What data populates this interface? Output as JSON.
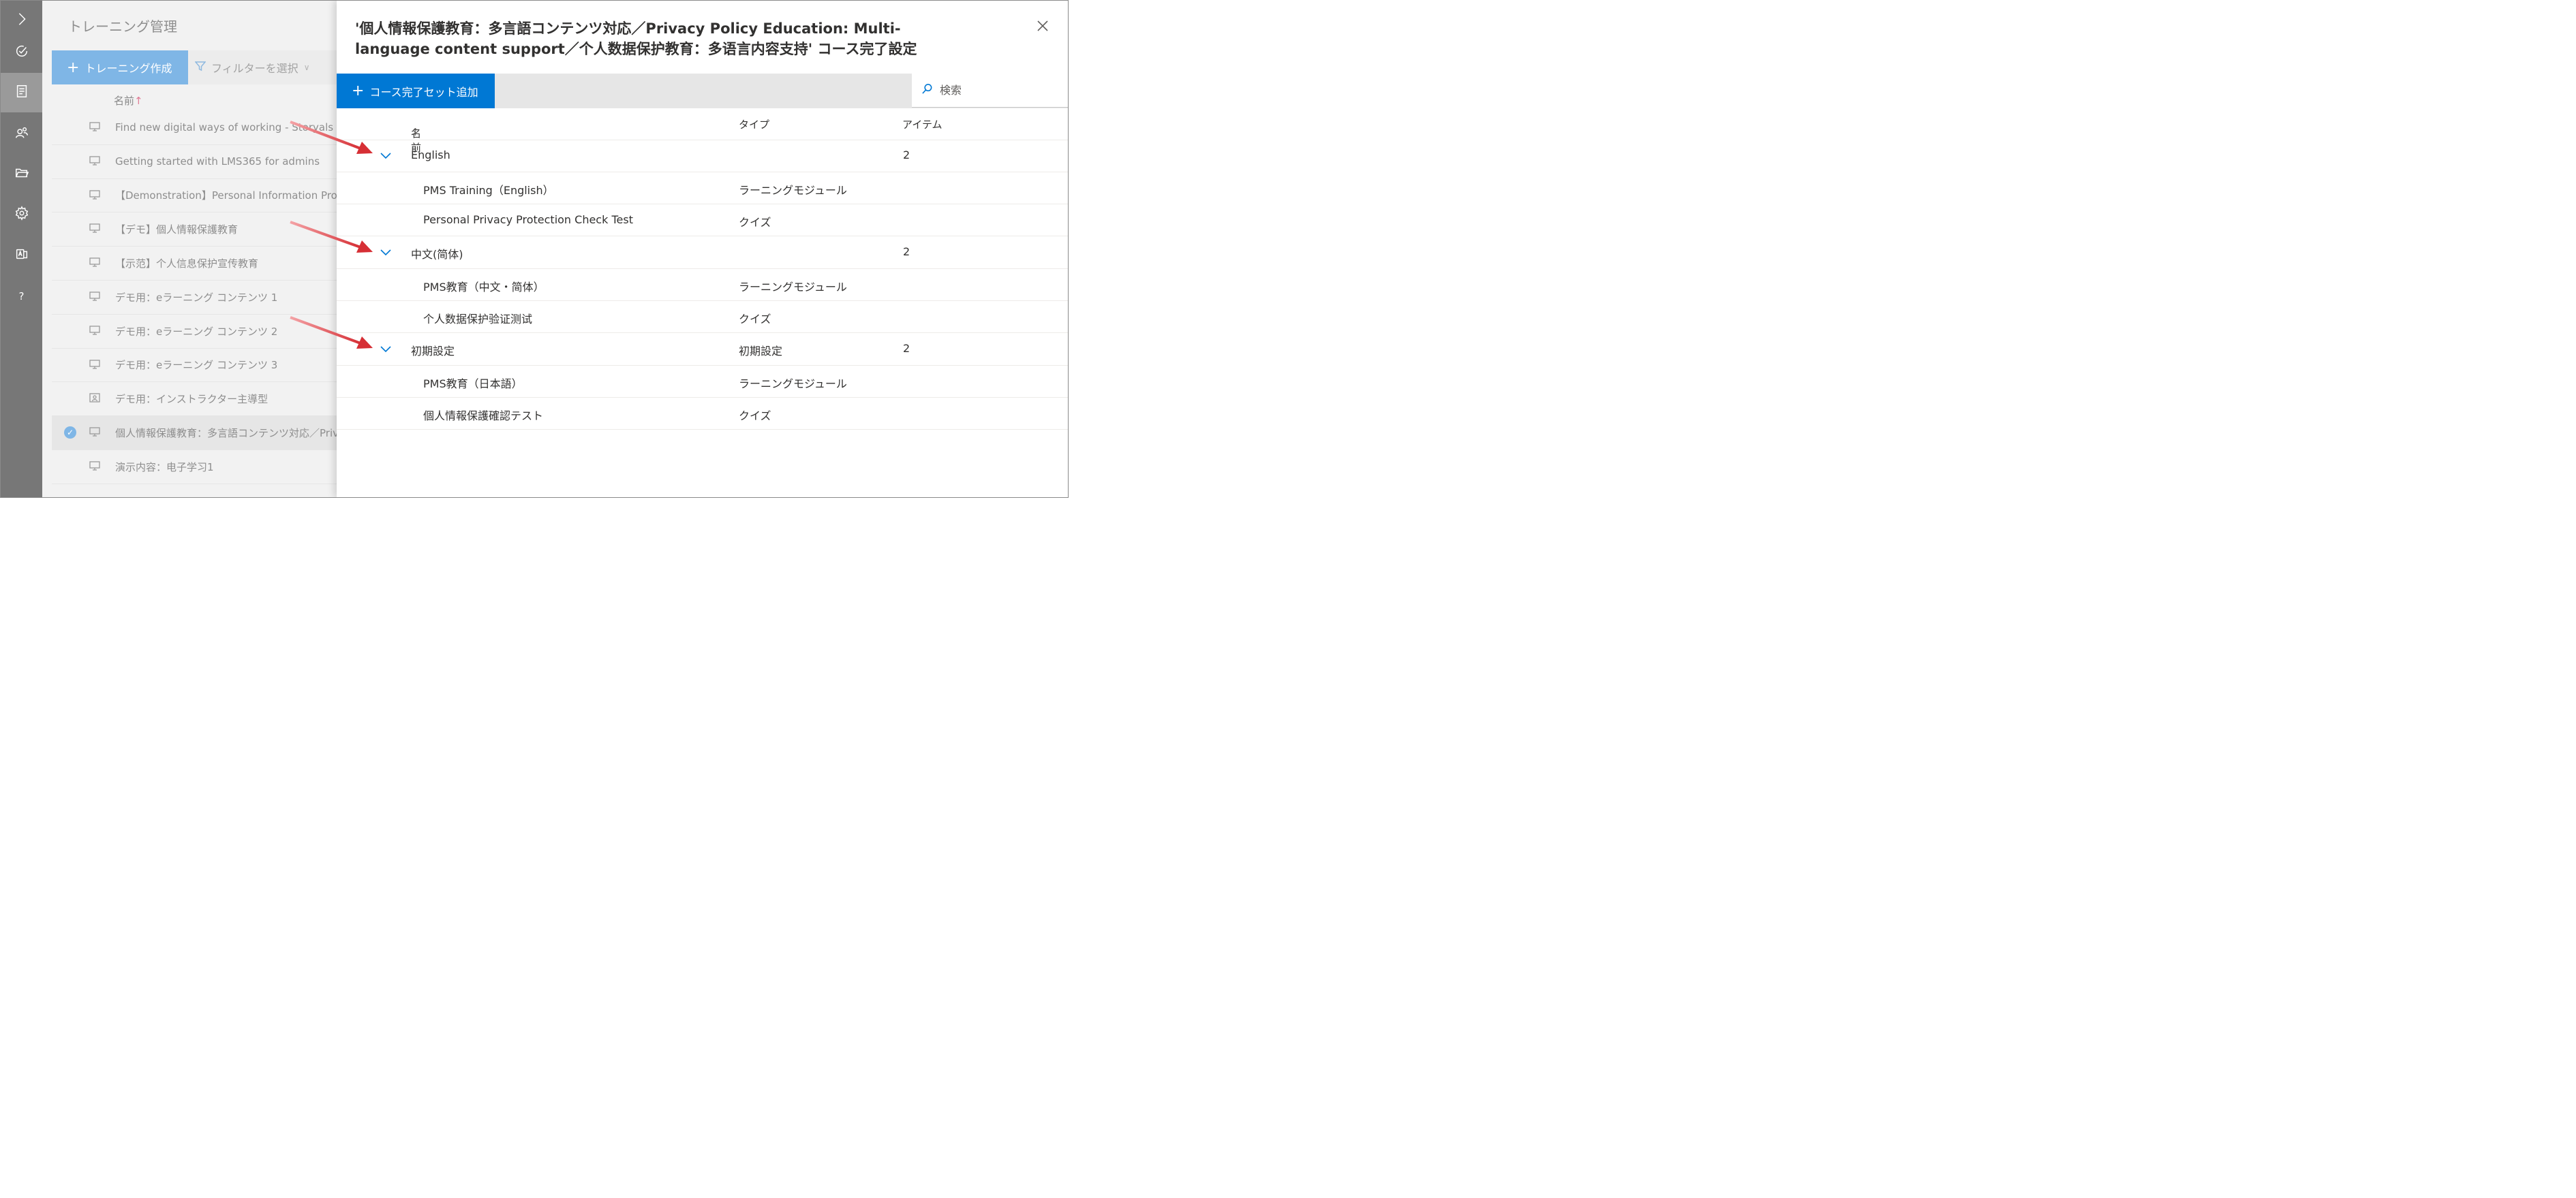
{
  "sidebar": {
    "items": [
      {
        "icon": "chevron-right-icon"
      },
      {
        "icon": "check-circle-icon"
      },
      {
        "icon": "document-icon",
        "active": true
      },
      {
        "icon": "users-icon"
      },
      {
        "icon": "folder-icon"
      },
      {
        "icon": "gear-icon"
      },
      {
        "icon": "translate-icon"
      },
      {
        "icon": "help-icon",
        "label": "?"
      }
    ]
  },
  "background": {
    "title": "トレーニング管理",
    "create_label": "トレーニング作成",
    "filter_label": "フィルターを選択",
    "column_name": "名前",
    "sort_arrow": "↑",
    "rows": [
      {
        "label": "Find new digital ways of working - Storyals"
      },
      {
        "label": "Getting started with LMS365 for admins"
      },
      {
        "label": "【Demonstration】Personal Information Protection"
      },
      {
        "label": "【デモ】個人情報保護教育"
      },
      {
        "label": "【示范】个人信息保护宣传教育"
      },
      {
        "label": "デモ用：eラーニング コンテンツ 1"
      },
      {
        "label": "デモ用：eラーニング コンテンツ 2"
      },
      {
        "label": "デモ用：eラーニング コンテンツ 3"
      },
      {
        "label": "デモ用：インストラクター主導型"
      },
      {
        "label": "個人情報保護教育：多言語コンテンツ対応／Privacy",
        "selected": true
      },
      {
        "label": "演示内容：电子学习1"
      }
    ]
  },
  "panel": {
    "title": "'個人情報保護教育：多言語コンテンツ対応／Privacy Policy Education: Multi-language content support／个人数据保护教育：多语言内容支持' コース完了設定",
    "add_label": "コース完了セット追加",
    "search_placeholder": "検索",
    "columns": {
      "name": "名前",
      "sort_arrow": "↑",
      "type": "タイプ",
      "items": "アイテム"
    },
    "groups": [
      {
        "name": "English",
        "type": "",
        "count": "2",
        "items": [
          {
            "name": "PMS Training（English）",
            "type": "ラーニングモジュール"
          },
          {
            "name": "Personal Privacy Protection Check Test",
            "type": "クイズ"
          }
        ]
      },
      {
        "name": "中文(简体)",
        "type": "",
        "count": "2",
        "items": [
          {
            "name": "PMS教育（中文・简体）",
            "type": "ラーニングモジュール"
          },
          {
            "name": "个人数据保护验证测试",
            "type": "クイズ"
          }
        ]
      },
      {
        "name": "初期設定",
        "type": "初期設定",
        "count": "2",
        "items": [
          {
            "name": "PMS教育（日本語）",
            "type": "ラーニングモジュール"
          },
          {
            "name": "個人情報保護確認テスト",
            "type": "クイズ"
          }
        ]
      }
    ]
  },
  "colors": {
    "accent": "#0078d4",
    "rail": "#777777",
    "annotation": "#d9363e"
  }
}
